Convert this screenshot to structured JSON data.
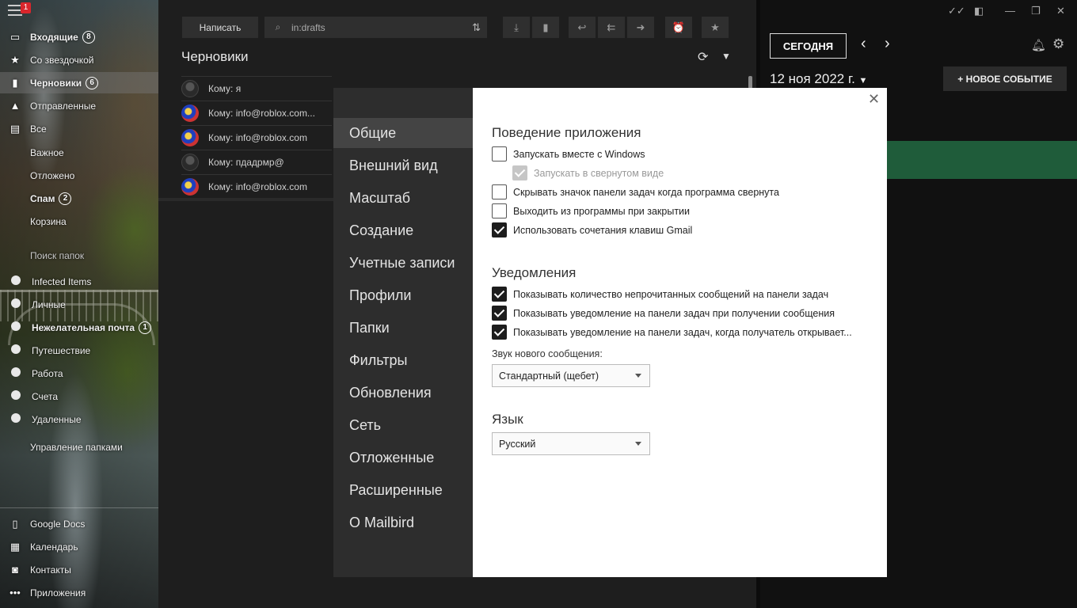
{
  "sidebar": {
    "menu_badge": "1",
    "nav": [
      {
        "label": "Входящие",
        "count": "8",
        "icon": "inbox-icon",
        "glyph": "▭",
        "bold": true
      },
      {
        "label": "Со звездочкой",
        "count": null,
        "icon": "star-icon",
        "glyph": "★",
        "bold": false
      },
      {
        "label": "Черновики",
        "count": "6",
        "icon": "drafts-icon",
        "glyph": "▮",
        "bold": true,
        "active": true
      },
      {
        "label": "Отправленные",
        "count": null,
        "icon": "sent-icon",
        "glyph": "▲",
        "bold": false
      },
      {
        "label": "Все",
        "count": null,
        "icon": "all-mail-icon",
        "glyph": "▤",
        "bold": false
      },
      {
        "label": "Важное",
        "count": null,
        "icon": null,
        "glyph": "",
        "bold": false
      },
      {
        "label": "Отложено",
        "count": null,
        "icon": null,
        "glyph": "",
        "bold": false
      },
      {
        "label": "Спам",
        "count": "2",
        "icon": null,
        "glyph": "",
        "bold": true
      },
      {
        "label": "Корзина",
        "count": null,
        "icon": null,
        "glyph": "",
        "bold": false
      }
    ],
    "folder_search": "Поиск папок",
    "folders": [
      {
        "label": "Infected Items",
        "count": null,
        "bold": false
      },
      {
        "label": "Личные",
        "count": null,
        "bold": false
      },
      {
        "label": "Нежелательная почта",
        "count": "1",
        "bold": true
      },
      {
        "label": "Путешествие",
        "count": null,
        "bold": false
      },
      {
        "label": "Работа",
        "count": null,
        "bold": false
      },
      {
        "label": "Счета",
        "count": null,
        "bold": false
      },
      {
        "label": "Удаленные",
        "count": null,
        "bold": false
      }
    ],
    "manage_folders": "Управление папками",
    "apps": [
      {
        "label": "Google Docs",
        "icon": "google-docs-icon",
        "glyph": "▯"
      },
      {
        "label": "Календарь",
        "icon": "calendar-icon",
        "glyph": "▦"
      },
      {
        "label": "Контакты",
        "icon": "contacts-icon",
        "glyph": "◙"
      },
      {
        "label": "Приложения",
        "icon": "apps-icon",
        "glyph": "•••"
      }
    ]
  },
  "toolbar": {
    "compose": "Написать",
    "search_value": "in:drafts"
  },
  "mail": {
    "folder_title": "Черновики",
    "rows": [
      {
        "to": "Кому: я",
        "avatar": "gray"
      },
      {
        "to": "Кому: info@roblox.com...",
        "avatar": "globe"
      },
      {
        "to": "Кому: info@roblox.com",
        "avatar": "globe"
      },
      {
        "to": "Кому: пдадрмр@",
        "avatar": "gray"
      },
      {
        "to": "Кому: info@roblox.com",
        "avatar": "globe"
      }
    ]
  },
  "calendar": {
    "today": "СЕГОДНЯ",
    "date": "12 ноя 2022 г.",
    "new_event": "+ НОВОЕ СОБЫТИЕ"
  },
  "settings": {
    "nav": [
      "Общие",
      "Внешний вид",
      "Масштаб",
      "Создание",
      "Учетные записи",
      "Профили",
      "Папки",
      "Фильтры",
      "Обновления",
      "Сеть",
      "Отложенные",
      "Расширенные",
      "О Mailbird"
    ],
    "active_nav": 0,
    "behavior_title": "Поведение приложения",
    "behavior": [
      {
        "label": "Запускать вместе с Windows",
        "checked": false,
        "disabled": false
      },
      {
        "label": "Запускать в свернутом виде",
        "checked": true,
        "disabled": true
      },
      {
        "label": "Скрывать значок панели задач когда программа свернута",
        "checked": false,
        "disabled": false
      },
      {
        "label": "Выходить из программы при закрытии",
        "checked": false,
        "disabled": false
      },
      {
        "label": "Использовать сочетания клавиш Gmail",
        "checked": true,
        "disabled": false
      }
    ],
    "notifications_title": "Уведомления",
    "notifications": [
      {
        "label": "Показывать количество непрочитанных сообщений на панели задач",
        "checked": true
      },
      {
        "label": "Показывать уведомление на панели задач при получении сообщения",
        "checked": true
      },
      {
        "label": "Показывать уведомление на панели задач, когда получатель открывает...",
        "checked": true
      }
    ],
    "sound_label": "Звук нового сообщения:",
    "sound_value": "Стандартный (щебет)",
    "language_title": "Язык",
    "language_value": "Русский"
  }
}
